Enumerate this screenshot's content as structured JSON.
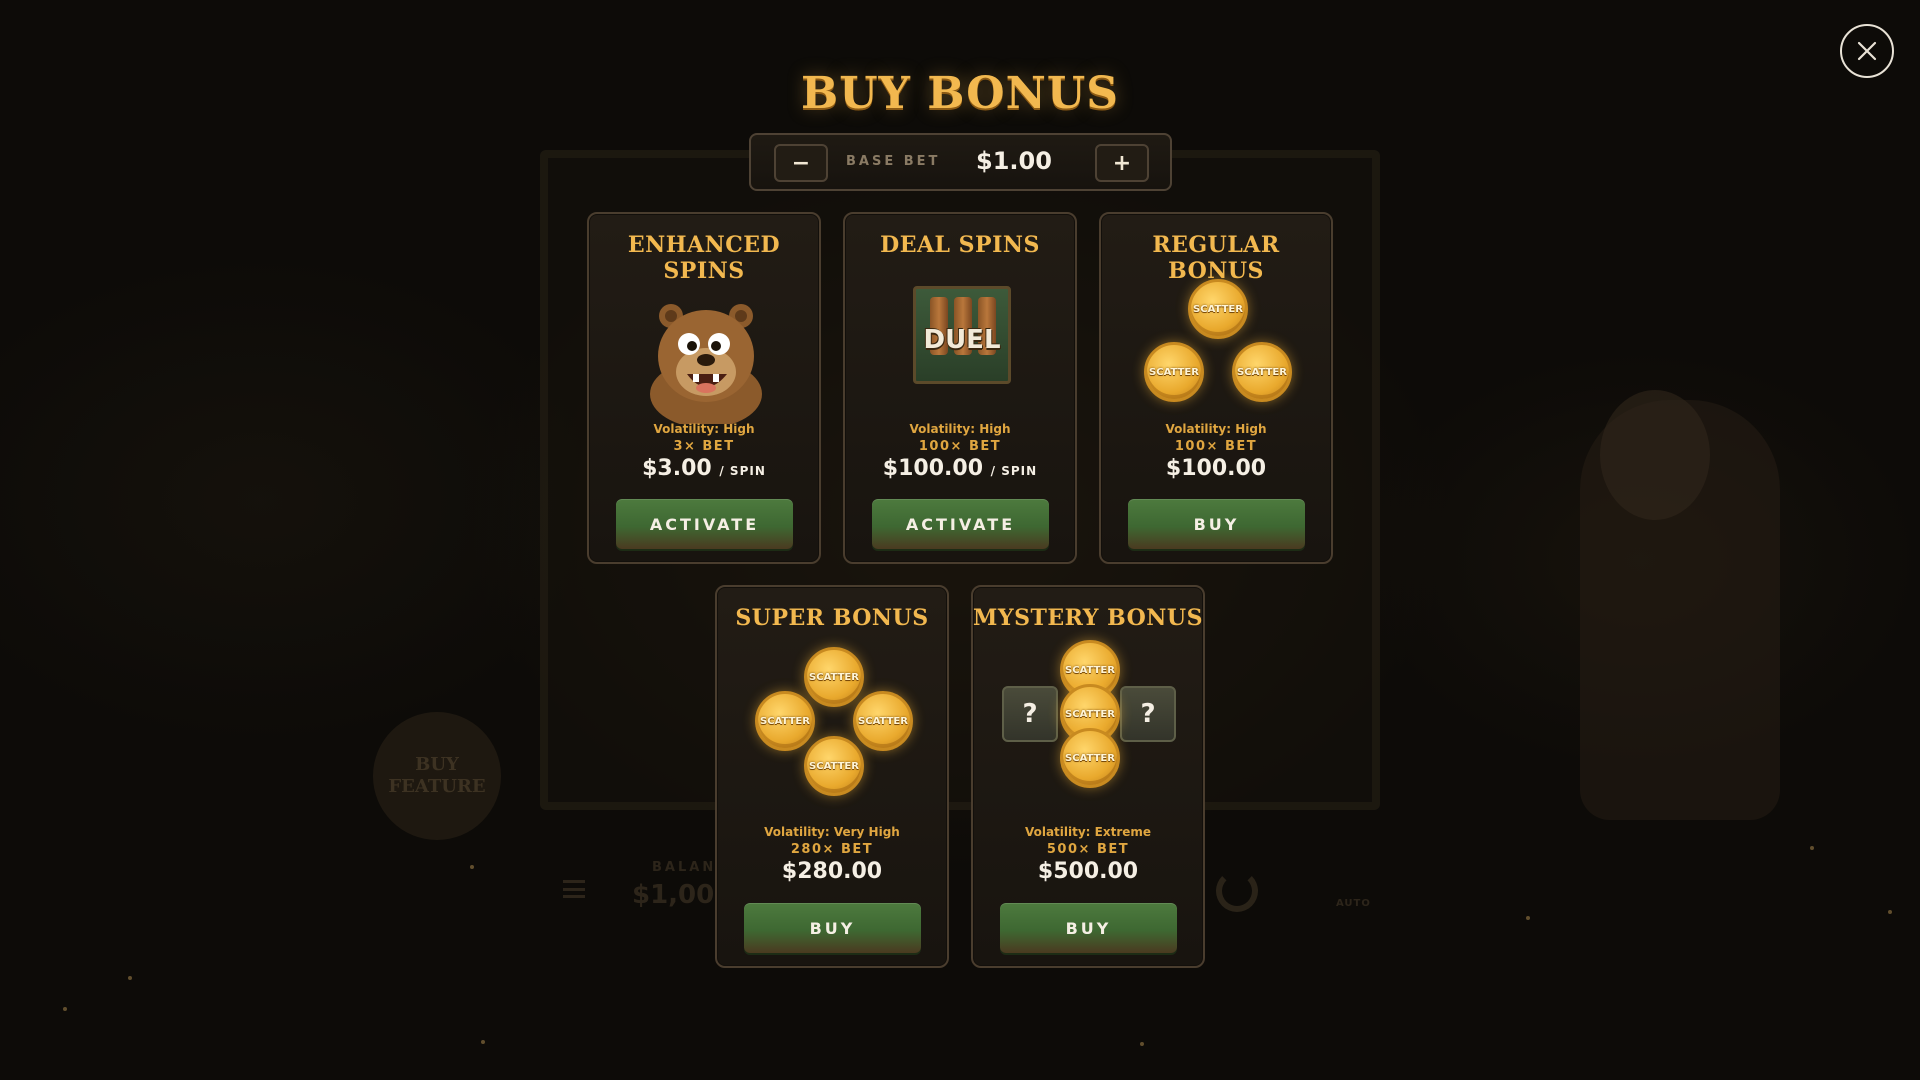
{
  "background": {
    "buy_feature_label": "BUY\nFEATURE",
    "balance_label": "BALANCE",
    "balance_value": "$1,00",
    "auto_label": "AUTO"
  },
  "modal": {
    "title": "BUY BONUS",
    "close_icon": "close-icon",
    "base_bet": {
      "label": "BASE BET",
      "value": "$1.00",
      "decrease_label": "−",
      "increase_label": "+"
    },
    "cards": [
      {
        "title": "ENHANCED SPINS",
        "art": "bear-icon",
        "volatility": "Volatility: High",
        "multiplier": "3× BET",
        "price": "$3.00",
        "price_unit": "/ SPIN",
        "button_label": "ACTIVATE"
      },
      {
        "title": "DEAL SPINS",
        "art": "duel-icon",
        "art_text": "DUEL",
        "volatility": "Volatility: High",
        "multiplier": "100× BET",
        "price": "$100.00",
        "price_unit": "/ SPIN",
        "button_label": "ACTIVATE"
      },
      {
        "title": "REGULAR BONUS",
        "art": "scatter-coins-3",
        "volatility": "Volatility: High",
        "multiplier": "100× BET",
        "price": "$100.00",
        "button_label": "BUY"
      },
      {
        "title": "SUPER BONUS",
        "art": "scatter-coins-4",
        "volatility": "Volatility: Very High",
        "multiplier": "280× BET",
        "price": "$280.00",
        "button_label": "BUY"
      },
      {
        "title": "MYSTERY BONUS",
        "art": "scatter-coins-3-mystery",
        "mystery_symbol": "?",
        "volatility": "Volatility: Extreme",
        "multiplier": "500× BET",
        "price": "$500.00",
        "button_label": "BUY"
      }
    ],
    "scatter_label": "SCATTER"
  },
  "colors": {
    "title_gold": "#f2b84f",
    "button_green": "#4d7a3e",
    "card_border": "#4a3d2e"
  }
}
